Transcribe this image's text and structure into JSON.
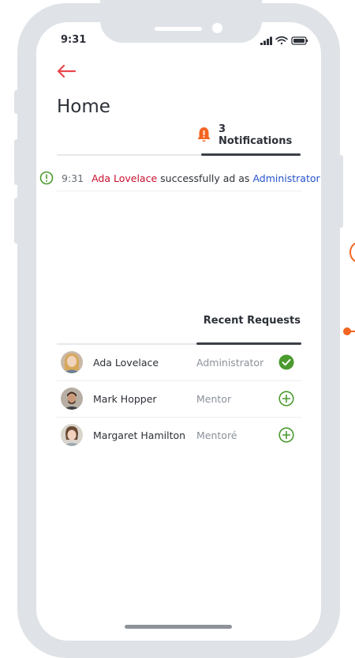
{
  "status_bar": {
    "time": "9:31"
  },
  "header": {
    "title": "Home",
    "back_icon": "back-arrow-icon"
  },
  "notifications": {
    "tab_label": "3 Notifications",
    "items": [
      {
        "time": "9:31",
        "user": "Ada Lovelace",
        "text": "successfully ad as",
        "role": "Administrator",
        "icon": "alert-circle-icon"
      }
    ]
  },
  "requests": {
    "tab_label": "Recent Requests",
    "rows": [
      {
        "name": "Ada Lovelace",
        "role": "Administrator",
        "action_icon": "check-circle-icon",
        "approved": true
      },
      {
        "name": "Mark Hopper",
        "role": "Mentor",
        "action_icon": "add-circle-icon",
        "approved": false
      },
      {
        "name": "Margaret Hamilton",
        "role": "Mentoré",
        "action_icon": "add-circle-icon",
        "approved": false
      }
    ]
  },
  "colors": {
    "accent": "#e8474c",
    "user_highlight": "#c8102e",
    "role_link": "#2351c9",
    "success": "#4a9a2e",
    "bell": "#f26522"
  }
}
